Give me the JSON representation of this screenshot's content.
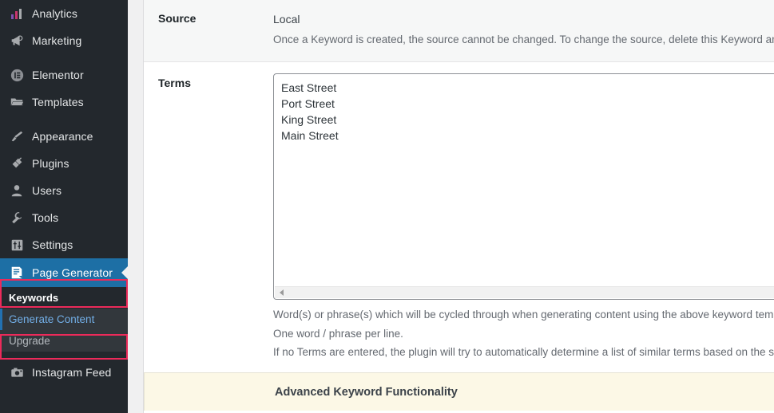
{
  "sidebar": {
    "items": [
      {
        "label": "Analytics",
        "icon": "bar-chart-icon",
        "type": "item"
      },
      {
        "label": "Marketing",
        "icon": "megaphone-icon",
        "type": "item"
      },
      {
        "label": "",
        "icon": "",
        "type": "separator"
      },
      {
        "label": "Elementor",
        "icon": "elementor-icon",
        "type": "item"
      },
      {
        "label": "Templates",
        "icon": "folder-icon",
        "type": "item"
      },
      {
        "label": "",
        "icon": "",
        "type": "separator"
      },
      {
        "label": "Appearance",
        "icon": "paintbrush-icon",
        "type": "item"
      },
      {
        "label": "Plugins",
        "icon": "plug-icon",
        "type": "item"
      },
      {
        "label": "Users",
        "icon": "user-icon",
        "type": "item"
      },
      {
        "label": "Tools",
        "icon": "wrench-icon",
        "type": "item"
      },
      {
        "label": "Settings",
        "icon": "sliders-icon",
        "type": "item"
      }
    ],
    "current_item": {
      "label": "Page Generator",
      "icon": "document-lines-icon"
    },
    "submenu": {
      "header": "Keywords",
      "items": [
        {
          "label": "Generate Content",
          "active": true
        },
        {
          "label": "Upgrade",
          "active": false
        }
      ]
    },
    "trailing_items": [
      {
        "label": "Instagram Feed",
        "icon": "camera-icon",
        "type": "item"
      }
    ],
    "colors": {
      "background": "#23282d",
      "submenu_background": "#32373c",
      "current_background": "#1d6fa5",
      "highlight_border": "#ec2a5a",
      "active_link": "#72aee6"
    }
  },
  "main": {
    "source_row": {
      "label": "Source",
      "value": "Local",
      "description": "Once a Keyword is created, the source cannot be changed. To change the source, delete this Keyword and cre"
    },
    "terms_row": {
      "label": "Terms",
      "terms": [
        "East Street",
        "Port Street",
        "King Street",
        "Main Street"
      ],
      "descriptions": [
        "Word(s) or phrase(s) which will be cycled through when generating content using the above keyword templat",
        "One word / phrase per line.",
        "If no Terms are entered, the plugin will try to automatically determine a list of similar terms based on the supp"
      ]
    },
    "advanced_banner": {
      "title": "Advanced Keyword Functionality",
      "background": "#fcf8e6"
    }
  }
}
